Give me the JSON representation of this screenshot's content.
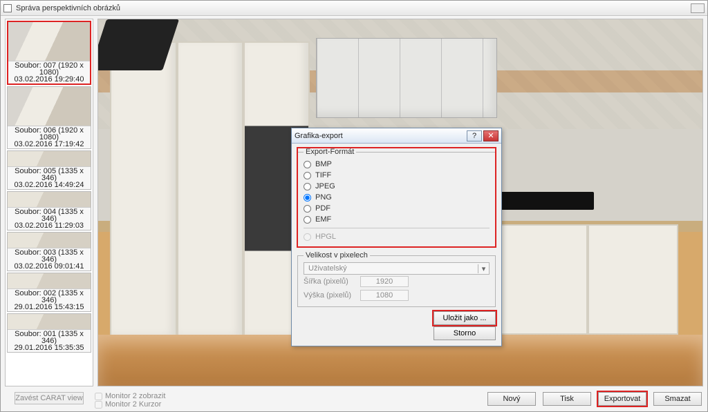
{
  "window": {
    "title": "Správa perspektivních obrázků"
  },
  "sidebar": {
    "thumbs": [
      {
        "line1": "Soubor: 007 (1920 x 1080)",
        "line2": "03.02.2016   19:29:40",
        "size": "big",
        "selected": true
      },
      {
        "line1": "Soubor: 006 (1920 x 1080)",
        "line2": "03.02.2016   17:19:42",
        "size": "big",
        "selected": false
      },
      {
        "line1": "Soubor: 005 (1335 x 346)",
        "line2": "03.02.2016   14:49:24",
        "size": "small",
        "selected": false
      },
      {
        "line1": "Soubor: 004 (1335 x 346)",
        "line2": "03.02.2016   11:29:03",
        "size": "small",
        "selected": false
      },
      {
        "line1": "Soubor: 003 (1335 x 346)",
        "line2": "03.02.2016   09:01:41",
        "size": "small",
        "selected": false
      },
      {
        "line1": "Soubor: 002 (1335 x 346)",
        "line2": "29.01.2016   15:43:15",
        "size": "small",
        "selected": false
      },
      {
        "line1": "Soubor: 001 (1335 x 346)",
        "line2": "29.01.2016   15:35:35",
        "size": "small",
        "selected": false
      }
    ]
  },
  "zavest_btn": "Zavést CARAT view",
  "monitors": {
    "zobrazit": "Monitor 2 zobrazit",
    "kurzor": "Monitor 2 Kurzor"
  },
  "footer": {
    "novy": "Nový",
    "tisk": "Tisk",
    "export": "Exportovat",
    "smazat": "Smazat"
  },
  "modal": {
    "title": "Grafika-export",
    "fieldset_format": "Export-Formát",
    "formats": {
      "bmp": "BMP",
      "tiff": "TIFF",
      "jpeg": "JPEG",
      "png": "PNG",
      "pdf": "PDF",
      "emf": "EMF",
      "hpgl": "HPGL"
    },
    "selected_format": "png",
    "fieldset_size": "Velikost v pixelech",
    "size_combo": "Uživatelský",
    "width_label": "Šířka (pixelů)",
    "width_value": "1920",
    "height_label": "Výška (pixelů)",
    "height_value": "1080",
    "save_as": "Uložit jako ...",
    "cancel": "Storno"
  }
}
